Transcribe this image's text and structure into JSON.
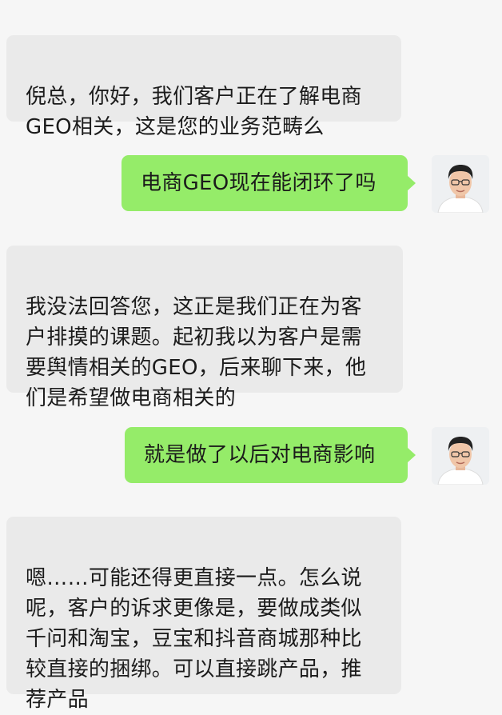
{
  "messages": [
    {
      "side": "received",
      "text": "倪总，你好，我们客户正在了解电商GEO相关，这是您的业务范畴么"
    },
    {
      "side": "sent",
      "text": "电商GEO现在能闭环了吗"
    },
    {
      "side": "received",
      "text": "我没法回答您，这正是我们正在为客户排摸的课题。起初我以为客户是需要舆情相关的GEO，后来聊下来，他们是希望做电商相关的"
    },
    {
      "side": "sent",
      "text": "就是做了以后对电商影响"
    },
    {
      "side": "received",
      "text": "嗯……可能还得更直接一点。怎么说呢，客户的诉求更像是，要做成类似千问和淘宝，豆宝和抖音商城那种比较直接的捆绑。可以直接跳产品，推荐产品"
    }
  ],
  "display_lines": {
    "m0": "倪总，你好，我们客户正在了解电商\nGEO相关，这是您的业务范畴么",
    "m2": "我没法回答您，这正是我们正在为客\n户排摸的课题。起初我以为客户是需\n要舆情相关的GEO，后来聊下来，他\n们是希望做电商相关的",
    "m4": "嗯……可能还得更直接一点。怎么说\n呢，客户的诉求更像是，要做成类似\n千问和淘宝，豆宝和抖音商城那种比\n较直接的捆绑。可以直接跳产品，推\n荐产品"
  },
  "avatar": {
    "icon": "user-avatar-icon"
  },
  "colors": {
    "background": "#f6f6f6",
    "received_bubble": "#eaeaea",
    "sent_bubble": "#95ec69",
    "text": "#1b1b1b"
  }
}
